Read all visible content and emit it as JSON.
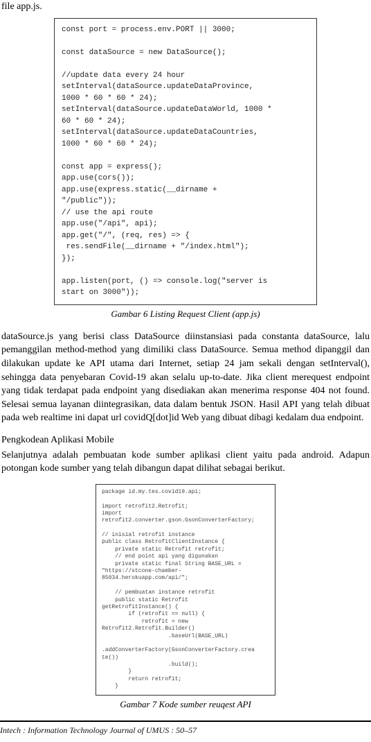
{
  "intro": "file app.js.",
  "code1": "const port = process.env.PORT || 3000;\n\nconst dataSource = new DataSource();\n\n//update data every 24 hour\nsetInterval(dataSource.updateDataProvince,\n1000 * 60 * 60 * 24);\nsetInterval(dataSource.updateDataWorld, 1000 *\n60 * 60 * 24);\nsetInterval(dataSource.updateDataCountries,\n1000 * 60 * 60 * 24);\n\nconst app = express();\napp.use(cors());\napp.use(express.static(__dirname +\n\"/public\"));\n// use the api route\napp.use(\"/api\", api);\napp.get(\"/\", (req, res) => {\n res.sendFile(__dirname + \"/index.html\");\n});\n\napp.listen(port, () => console.log(\"server is\nstart on 3000\"));",
  "caption1": "Gambar 6 Listing Request Client (app.js)",
  "paragraph1": "dataSource.js yang berisi class DataSource diinstansiasi pada constanta dataSource, lalu pemanggilan method-method yang dimiliki class DataSource. Semua method dipanggil dan dilakukan update ke API utama dari Internet, setiap 24 jam sekali dengan setInterval(), sehingga data penyebaran Covid-19 akan selalu up-to-date. Jika client merequest endpoint yang tidak terdapat pada endpoint yang disediakan akan menerima response 404 not found. Selesai semua layanan diintegrasikan, data dalam bentuk JSON. Hasil API yang telah dibuat pada web realtime ini dapat url covidQ[dot]id Web yang dibuat dibagi kedalam dua endpoint.",
  "subheading": "Pengkodean Aplikasi Mobile",
  "paragraph2": "Selanjutnya adalah pembuatan kode sumber aplikasi client yaitu pada android. Adapun potongan kode sumber yang telah dibangun dapat dilihat sebagai berikut.",
  "code2": "package id.my.tes.covid19.api;\n\nimport retrofit2.Retrofit;\nimport\nretrofit2.converter.gson.GsonConverterFactory;\n\n// inisial retrofit instance\npublic class RetrofitClientInstance {\n    private static Retrofit retrofit;\n    // end point api yang digunakan\n    private static final String BASE_URL =\n\"https://stcone-chamber-\n85034.herokuapp.com/api/\";\n\n    // pembuatan instance retrofit\n    public static Retrofit\ngetRetrofitInstance() {\n        if (retrofit == null) {\n            retrofit = new\nRetrofit2.Retrofit.Builder()\n                    .baseUrl(BASE_URL)\n\n.addConverterFactory(GsonConverterFactory.crea\nte())\n                    .build();\n        }\n        return retrofit;\n    }",
  "caption2": "Gambar 7 Kode sumber reuqest API",
  "footer": "Intech : Information Technology Journal of UMUS : 50–57"
}
